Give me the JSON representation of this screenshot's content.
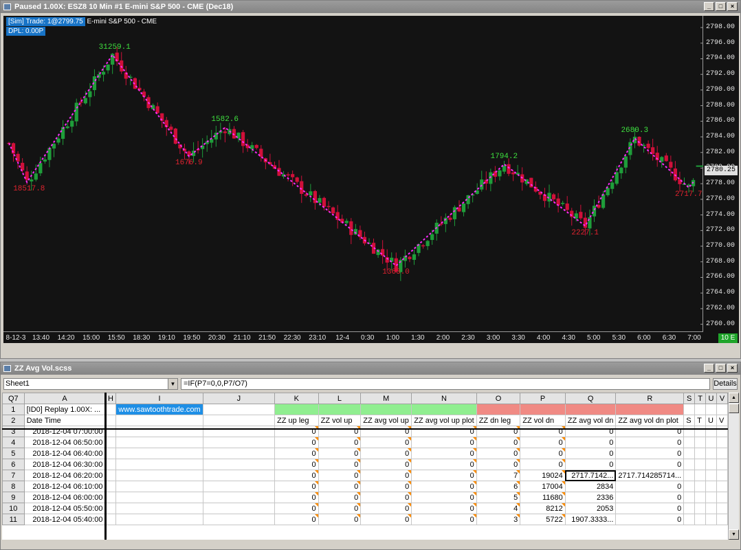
{
  "chart_window": {
    "title": "Paused 1.00X: ESZ8  10 Min  #1  E-mini S&P 500 - CME (Dec18)",
    "sim_badge": "[Sim]",
    "trade_info": "Trade: 1@2799.75",
    "instrument": "E-mini S&P 500 - CME",
    "dpl": "DPL: 0.00P",
    "last_price": "2780.25",
    "timeframe": "10 E",
    "colors": {
      "up_candle": "#1f9d3a",
      "down_candle": "#d0103a",
      "zigzag": "#ff2bff",
      "background": "#131313"
    }
  },
  "chart_data": {
    "type": "candlestick",
    "y_ticks": [
      "2798.00",
      "2796.00",
      "2794.00",
      "2792.00",
      "2790.00",
      "2788.00",
      "2786.00",
      "2784.00",
      "2782.00",
      "2780.00",
      "2778.00",
      "2776.00",
      "2774.00",
      "2772.00",
      "2770.00",
      "2768.00",
      "2766.00",
      "2764.00",
      "2762.00",
      "2760.00"
    ],
    "ylim": [
      2759,
      2799.5
    ],
    "x_ticks": [
      "8-12-3",
      "13:40",
      "14:20",
      "15:00",
      "15:50",
      "18:30",
      "19:10",
      "19:50",
      "20:30",
      "21:10",
      "21:50",
      "22:30",
      "23:10",
      "12-4",
      "0:30",
      "1:00",
      "1:30",
      "2:00",
      "2:30",
      "3:00",
      "3:30",
      "4:00",
      "4:30",
      "5:00",
      "5:30",
      "6:00",
      "6:30",
      "7:00"
    ],
    "zigzag_points": [
      {
        "bar": 0,
        "price": 2783.2
      },
      {
        "bar": 4,
        "price": 2778.2,
        "label": "18517.8",
        "kind": "low"
      },
      {
        "bar": 23,
        "price": 2794.5,
        "label": "31259.1",
        "kind": "high"
      },
      {
        "bar": 40,
        "price": 2781.5,
        "label": "1676.9",
        "kind": "low"
      },
      {
        "bar": 48,
        "price": 2785.2,
        "label": "1582.6",
        "kind": "high"
      },
      {
        "bar": 86,
        "price": 2767.5,
        "label": "1363.0",
        "kind": "low"
      },
      {
        "bar": 110,
        "price": 2780.5,
        "label": "1794.2",
        "kind": "high"
      },
      {
        "bar": 128,
        "price": 2772.6,
        "label": "2227.1",
        "kind": "low"
      },
      {
        "bar": 139,
        "price": 2783.8,
        "label": "2680.3",
        "kind": "high"
      },
      {
        "bar": 151,
        "price": 2777.5,
        "label": "2717.7",
        "kind": "low"
      },
      {
        "bar": 152,
        "price": 2778.2
      }
    ]
  },
  "sheet_window": {
    "title": "ZZ Avg Vol.scss",
    "sheet_name": "Sheet1",
    "formula": "=IF(P7=0,0,P7/O7)",
    "details_label": "Details",
    "cell_ref": "Q7",
    "columns": [
      "A",
      "H",
      "I",
      "J",
      "K",
      "L",
      "M",
      "N",
      "O",
      "P",
      "Q",
      "R",
      "S",
      "T",
      "U",
      "V"
    ],
    "row1": {
      "a": "[ID0] Replay 1.00X: ...",
      "i": "www.sawtoothtrade.com"
    },
    "row2": {
      "a": "Date Time",
      "k": "ZZ up leg",
      "l": "ZZ vol up",
      "m": "ZZ avg vol up",
      "n": "ZZ avg vol up plot",
      "o": "ZZ dn leg",
      "p": "ZZ vol dn",
      "q": "ZZ avg vol dn",
      "r": "ZZ avg vol dn plot",
      "s": "S",
      "t": "T",
      "u": "U",
      "v": "V"
    },
    "rows": [
      {
        "n": "3",
        "date": "2018-12-04 07:00:00",
        "k": "0",
        "l": "0",
        "m": "0",
        "n2": "0",
        "o": "0",
        "p": "0",
        "q": "0",
        "r": "0"
      },
      {
        "n": "4",
        "date": "2018-12-04 06:50:00",
        "k": "0",
        "l": "0",
        "m": "0",
        "n2": "0",
        "o": "0",
        "p": "0",
        "q": "0",
        "r": "0"
      },
      {
        "n": "5",
        "date": "2018-12-04 06:40:00",
        "k": "0",
        "l": "0",
        "m": "0",
        "n2": "0",
        "o": "0",
        "p": "0",
        "q": "0",
        "r": "0"
      },
      {
        "n": "6",
        "date": "2018-12-04 06:30:00",
        "k": "0",
        "l": "0",
        "m": "0",
        "n2": "0",
        "o": "0",
        "p": "0",
        "q": "0",
        "r": "0"
      },
      {
        "n": "7",
        "date": "2018-12-04 06:20:00",
        "k": "0",
        "l": "0",
        "m": "0",
        "n2": "0",
        "o": "7",
        "p": "19024",
        "q": "2717.7142...",
        "r": "2717.714285714..."
      },
      {
        "n": "8",
        "date": "2018-12-04 06:10:00",
        "k": "0",
        "l": "0",
        "m": "0",
        "n2": "0",
        "o": "6",
        "p": "17004",
        "q": "2834",
        "r": "0"
      },
      {
        "n": "9",
        "date": "2018-12-04 06:00:00",
        "k": "0",
        "l": "0",
        "m": "0",
        "n2": "0",
        "o": "5",
        "p": "11680",
        "q": "2336",
        "r": "0"
      },
      {
        "n": "10",
        "date": "2018-12-04 05:50:00",
        "k": "0",
        "l": "0",
        "m": "0",
        "n2": "0",
        "o": "4",
        "p": "8212",
        "q": "2053",
        "r": "0"
      },
      {
        "n": "11",
        "date": "2018-12-04 05:40:00",
        "k": "0",
        "l": "0",
        "m": "0",
        "n2": "0",
        "o": "3",
        "p": "5722",
        "q": "1907.3333...",
        "r": "0"
      }
    ]
  }
}
